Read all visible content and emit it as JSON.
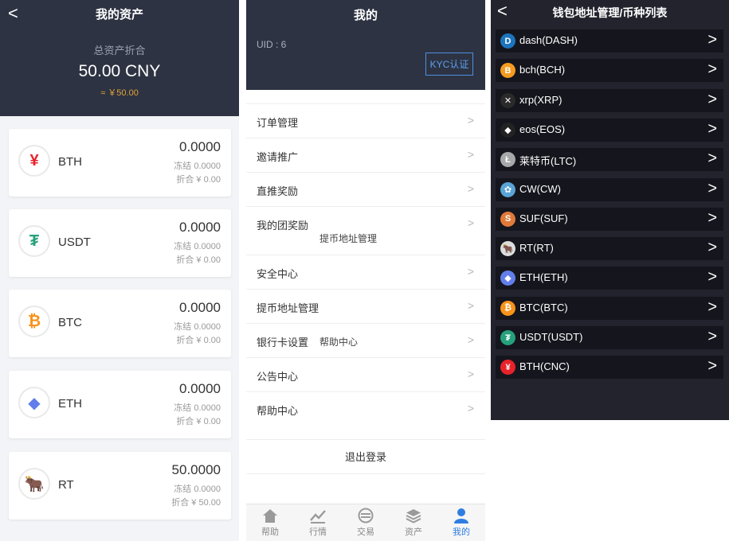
{
  "assets": {
    "back_glyph": "<",
    "title": "我的资产",
    "total_label": "总资产折合",
    "total_value": "50.00 CNY",
    "total_approx": "≈ ￥50.00",
    "coins": [
      {
        "symbol": "BTH",
        "icon": "yen-icon",
        "glyph": "¥",
        "color": "#e8222a",
        "balance": "0.0000",
        "frozen": "冻结 0.0000",
        "converted": "折合 ¥ 0.00"
      },
      {
        "symbol": "USDT",
        "icon": "tether-icon",
        "glyph": "₮",
        "color": "#26a17b",
        "balance": "0.0000",
        "frozen": "冻结 0.0000",
        "converted": "折合 ¥ 0.00"
      },
      {
        "symbol": "BTC",
        "icon": "bitcoin-icon",
        "glyph": "₿",
        "color": "#f7931a",
        "balance": "0.0000",
        "frozen": "冻结 0.0000",
        "converted": "折合 ¥ 0.00"
      },
      {
        "symbol": "ETH",
        "icon": "ethereum-icon",
        "glyph": "◆",
        "color": "#627eea",
        "balance": "0.0000",
        "frozen": "冻结 0.0000",
        "converted": "折合 ¥ 0.00"
      },
      {
        "symbol": "RT",
        "icon": "bull-icon",
        "glyph": "🐂",
        "color": "#333333",
        "balance": "50.0000",
        "frozen": "冻结 0.0000",
        "converted": "折合 ¥ 50.00"
      }
    ]
  },
  "mine": {
    "title": "我的",
    "uid": "UID : 6",
    "kyc_button": "KYC认证",
    "chevron": ">",
    "menu": [
      "订单管理",
      "邀请推广",
      "直推奖励",
      "我的团奖励",
      "安全中心",
      "提币地址管理",
      "银行卡设置",
      "公告中心",
      "帮助中心"
    ],
    "ghost_texts": [
      "提币地址管理",
      "帮助中心"
    ],
    "logout": "退出登录",
    "tabs": [
      {
        "label": "帮助",
        "icon": "home-icon"
      },
      {
        "label": "行情",
        "icon": "chart-icon"
      },
      {
        "label": "交易",
        "icon": "exchange-icon"
      },
      {
        "label": "资产",
        "icon": "layers-icon"
      },
      {
        "label": "我的",
        "icon": "user-icon",
        "active": true
      }
    ]
  },
  "wallet": {
    "back_glyph": "<",
    "title": "钱包地址管理/币种列表",
    "chevron": ">",
    "coins": [
      {
        "label": "dash(DASH)",
        "icon": "dash-icon",
        "glyph": "D",
        "color": "#1c75bc"
      },
      {
        "label": "bch(BCH)",
        "icon": "bch-icon",
        "glyph": "B",
        "color": "#f49c1f"
      },
      {
        "label": "xrp(XRP)",
        "icon": "xrp-icon",
        "glyph": "✕",
        "color": "#2a2a2a"
      },
      {
        "label": "eos(EOS)",
        "icon": "eos-icon",
        "glyph": "◆",
        "color": "#222222"
      },
      {
        "label": "莱特币(LTC)",
        "icon": "litecoin-icon",
        "glyph": "Ł",
        "color": "#a6a9aa"
      },
      {
        "label": "CW(CW)",
        "icon": "cw-icon",
        "glyph": "✿",
        "color": "#5aa3d6"
      },
      {
        "label": "SUF(SUF)",
        "icon": "suf-icon",
        "glyph": "S",
        "color": "#e07a3a"
      },
      {
        "label": "RT(RT)",
        "icon": "bull-icon",
        "glyph": "🐂",
        "color": "#dddddd"
      },
      {
        "label": "ETH(ETH)",
        "icon": "ethereum-icon",
        "glyph": "◆",
        "color": "#627eea"
      },
      {
        "label": "BTC(BTC)",
        "icon": "bitcoin-icon",
        "glyph": "₿",
        "color": "#f7931a"
      },
      {
        "label": "USDT(USDT)",
        "icon": "tether-icon",
        "glyph": "₮",
        "color": "#26a17b"
      },
      {
        "label": "BTH(CNC)",
        "icon": "yen-icon",
        "glyph": "¥",
        "color": "#e8222a"
      }
    ]
  }
}
